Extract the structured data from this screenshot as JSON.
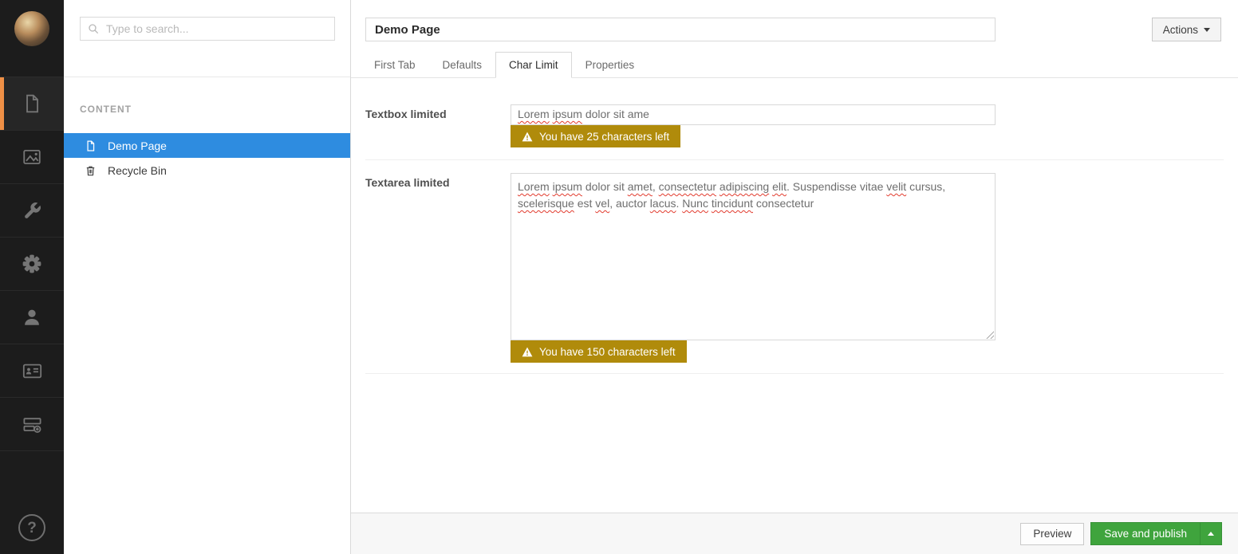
{
  "colors": {
    "section_accent_orange": "#ef9046",
    "tree_selection_blue": "#2e8ce0",
    "warning_gold": "#b08b0b",
    "save_green": "#3fa43d"
  },
  "sidebar": {
    "help_glyph": "?",
    "sections": [
      {
        "icon": "document-icon",
        "active": true
      },
      {
        "icon": "image-icon",
        "active": false
      },
      {
        "icon": "wrench-icon",
        "active": false
      },
      {
        "icon": "gear-icon",
        "active": false
      },
      {
        "icon": "user-icon",
        "active": false
      },
      {
        "icon": "id-card-icon",
        "active": false
      },
      {
        "icon": "server-add-icon",
        "active": false
      },
      {
        "icon": "help-icon",
        "active": false
      }
    ]
  },
  "tree": {
    "search": {
      "placeholder": "Type to search...",
      "value": ""
    },
    "header": "CONTENT",
    "items": [
      {
        "label": "Demo Page",
        "icon": "document-icon",
        "selected": true
      },
      {
        "label": "Recycle Bin",
        "icon": "trash-icon",
        "selected": false
      }
    ]
  },
  "editor": {
    "title": {
      "value": "Demo Page"
    },
    "actions_button": {
      "label": "Actions",
      "icon": "caret-down-icon"
    },
    "tabs": [
      {
        "label": "First Tab",
        "active": false
      },
      {
        "label": "Defaults",
        "active": false
      },
      {
        "label": "Char Limit",
        "active": true
      },
      {
        "label": "Properties",
        "active": false
      }
    ],
    "properties": [
      {
        "label": "Textbox limited",
        "type": "textbox",
        "value": "Lorem ipsum dolor sit ame",
        "segments": [
          {
            "text": "Lorem",
            "misspelled": true
          },
          {
            "text": " "
          },
          {
            "text": "ipsum",
            "misspelled": true
          },
          {
            "text": " dolor sit ame"
          }
        ],
        "warning": "You have 25 characters left"
      },
      {
        "label": "Textarea limited",
        "type": "textarea",
        "value": "Lorem ipsum dolor sit amet, consectetur adipiscing elit. Suspendisse vitae velit cursus, scelerisque est vel, auctor lacus. Nunc tincidunt consectetur",
        "segments": [
          {
            "text": "Lorem",
            "misspelled": true
          },
          {
            "text": " "
          },
          {
            "text": "ipsum",
            "misspelled": true
          },
          {
            "text": " dolor sit "
          },
          {
            "text": "amet",
            "misspelled": true
          },
          {
            "text": ", "
          },
          {
            "text": "consectetur",
            "misspelled": true
          },
          {
            "text": " "
          },
          {
            "text": "adipiscing",
            "misspelled": true
          },
          {
            "text": " "
          },
          {
            "text": "elit",
            "misspelled": true
          },
          {
            "text": ". Suspendisse vitae "
          },
          {
            "text": "velit",
            "misspelled": true
          },
          {
            "text": " cursus, "
          },
          {
            "text": "scelerisque",
            "misspelled": true
          },
          {
            "text": " est "
          },
          {
            "text": "vel",
            "misspelled": true
          },
          {
            "text": ", auctor "
          },
          {
            "text": "lacus",
            "misspelled": true
          },
          {
            "text": ". "
          },
          {
            "text": "Nunc",
            "misspelled": true
          },
          {
            "text": " "
          },
          {
            "text": "tincidunt",
            "misspelled": true
          },
          {
            "text": " consectetur"
          }
        ],
        "warning": "You have 150 characters left"
      }
    ]
  },
  "footer": {
    "preview_label": "Preview",
    "save_label": "Save and publish"
  }
}
